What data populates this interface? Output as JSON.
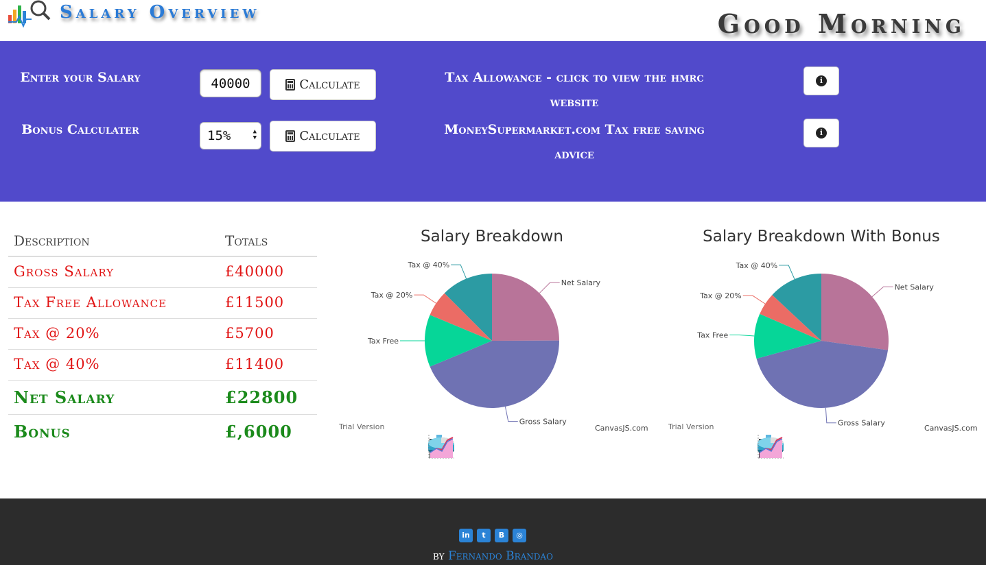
{
  "header": {
    "title": "Salary Overview",
    "greeting": "Good Morning"
  },
  "controls": {
    "salary_label": "Enter your Salary",
    "salary_value": "40000",
    "bonus_label": "Bonus Calculater",
    "bonus_selected": "15%",
    "calculate_label": "Calculate",
    "tax_allowance_label": "Tax Allowance - click to view the hmrc website",
    "msm_label": "MoneySupermarket.com Tax free saving advice"
  },
  "table": {
    "headers": [
      "Description",
      "Totals"
    ],
    "rows": [
      {
        "desc": "Gross Salary",
        "total": "£40000"
      },
      {
        "desc": "Tax Free Allowance",
        "total": "£11500"
      },
      {
        "desc": "Tax @ 20%",
        "total": "£5700"
      },
      {
        "desc": "Tax @ 40%",
        "total": "£11400"
      },
      {
        "desc": "Net Salary",
        "total": "£22800"
      },
      {
        "desc": "Bonus",
        "total": "£,6000"
      }
    ]
  },
  "chart_data": [
    {
      "type": "pie",
      "title": "Salary Breakdown",
      "categories": [
        "Net Salary",
        "Gross Salary",
        "Tax Free",
        "Tax @ 20%",
        "Tax @ 40%"
      ],
      "values": [
        22800,
        40000,
        11500,
        5700,
        11400
      ],
      "colors": [
        "#b87499",
        "#6f72b3",
        "#06d698",
        "#eb6c65",
        "#2c9ba3"
      ],
      "watermark": "Trial Version",
      "credit": "CanvasJS.com"
    },
    {
      "type": "pie",
      "title": "Salary Breakdown With Bonus",
      "categories": [
        "Net Salary",
        "Gross Salary",
        "Tax Free",
        "Tax @ 20%",
        "Tax @ 40%"
      ],
      "values": [
        28800,
        46000,
        11500,
        5700,
        13800
      ],
      "colors": [
        "#b87499",
        "#6f72b3",
        "#06d698",
        "#eb6c65",
        "#2c9ba3"
      ],
      "watermark": "Trial Version",
      "credit": "CanvasJS.com"
    }
  ],
  "footer": {
    "social_icons": [
      "linkedin-icon",
      "twitter-icon",
      "blogger-icon",
      "instagram-icon"
    ],
    "by": "by",
    "author": "Fernando Brandao"
  }
}
